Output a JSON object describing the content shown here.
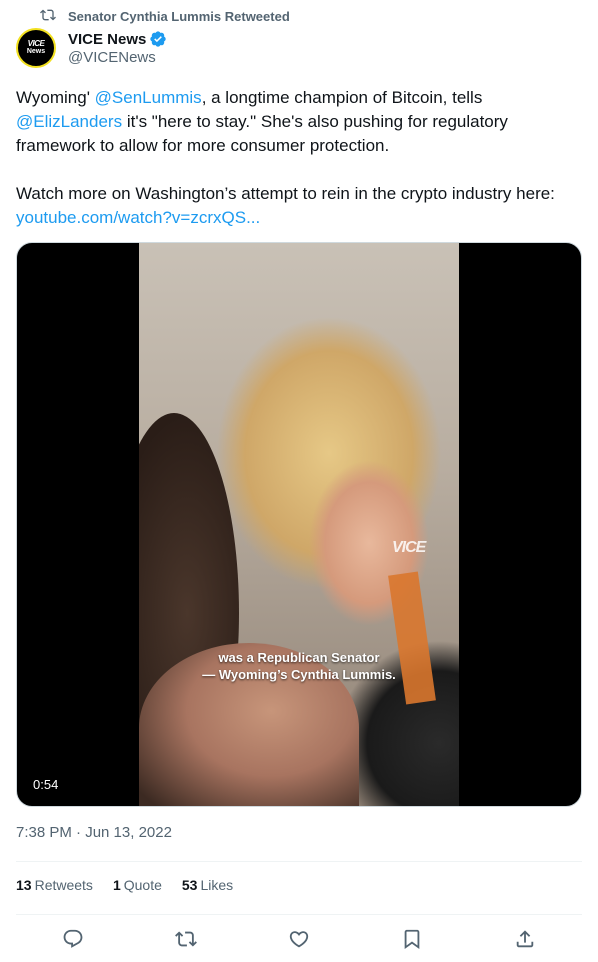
{
  "retweet_context": {
    "text": "Senator Cynthia Lummis Retweeted",
    "icon": "retweet-icon"
  },
  "author": {
    "display_name": "VICE News",
    "handle": "@VICENews",
    "avatar_text": "VICE News",
    "verified_color": "#1d9bf0"
  },
  "tweet": {
    "line1_pre": "Wyoming' ",
    "mention1": "@SenLummis",
    "line1_post": ", a longtime champion of Bitcoin, tells ",
    "mention2": "@ElizLanders",
    "line2_post": " it's \"here to stay.\" She's also pushing for regulatory framework to allow for more consumer protection.",
    "paragraph2": "Watch more on Washington’s attempt to rein in the crypto industry here:",
    "link": "youtube.com/watch?v=zcrxQS..."
  },
  "media": {
    "watermark": "VICE",
    "caption_line1": "was a Republican Senator",
    "caption_line2": "— Wyoming’s Cynthia Lummis.",
    "duration": "0:54"
  },
  "timestamp": "7:38 PM · Jun 13, 2022",
  "stats": {
    "retweets_count": "13",
    "retweets_label": "Retweets",
    "quotes_count": "1",
    "quotes_label": "Quote",
    "likes_count": "53",
    "likes_label": "Likes"
  },
  "colors": {
    "link": "#1d9bf0",
    "secondary_text": "#536471",
    "primary_text": "#0f1419"
  }
}
